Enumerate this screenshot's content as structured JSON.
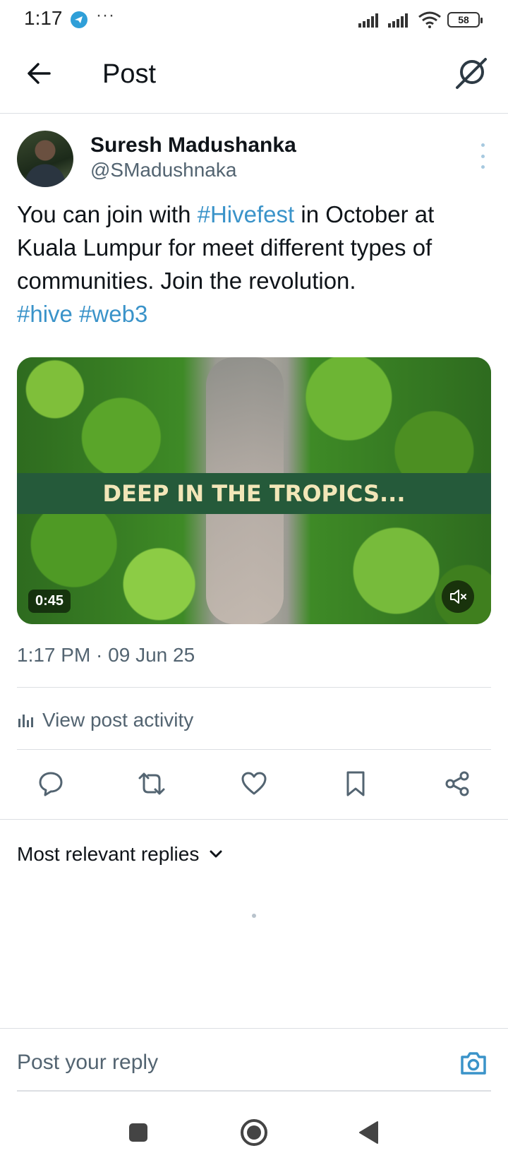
{
  "status_bar": {
    "time": "1:17",
    "dots": "···",
    "battery": "58"
  },
  "header": {
    "title": "Post"
  },
  "post": {
    "author_name": "Suresh Madushanka",
    "author_handle": "@SMadushnaka",
    "text_1": "You can join with ",
    "hashtag_1": "#Hivefest",
    "text_2": " in October at Kuala Lumpur for meet different types of communities. Join the revolution.",
    "hashtag_2": "#hive",
    "hashtag_3": "#web3",
    "media_caption": "DEEP IN THE TROPICS...",
    "media_duration": "0:45",
    "timestamp": "1:17 PM · 09 Jun 25",
    "activity_label": "View post activity"
  },
  "replies": {
    "sort_label": "Most relevant replies",
    "reply_placeholder": "Post your reply"
  },
  "colors": {
    "accent": "#3a93c9",
    "text": "#0f1419",
    "secondary": "#536471",
    "divider": "#dcdfe3"
  },
  "icons": {
    "back": "arrow-left-icon",
    "grok": "grok-icon",
    "more": "more-vertical-icon",
    "reply": "comment-icon",
    "repost": "repost-icon",
    "like": "heart-icon",
    "bookmark": "bookmark-icon",
    "share": "share-icon",
    "camera": "camera-icon",
    "activity": "bar-chart-icon",
    "mute": "volume-muted-icon"
  }
}
